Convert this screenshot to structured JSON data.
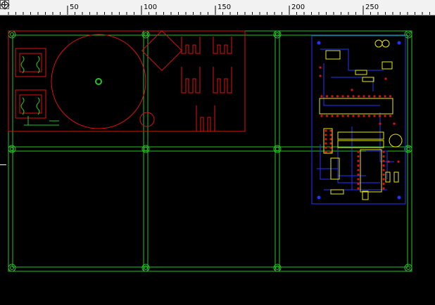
{
  "ruler": {
    "labels": [
      "50",
      "100",
      "150",
      "200",
      "250"
    ]
  },
  "icons": {
    "corner": "ruler-origin-icon",
    "right": "settings-gear-icon"
  },
  "colors": {
    "board_outline": "#22c322",
    "silkscreen_red": "#e01010",
    "pcb_blue": "#2233ff",
    "pad_yellow": "#e8e800",
    "ruler_bg": "#f2f2f2",
    "background": "#000000"
  }
}
